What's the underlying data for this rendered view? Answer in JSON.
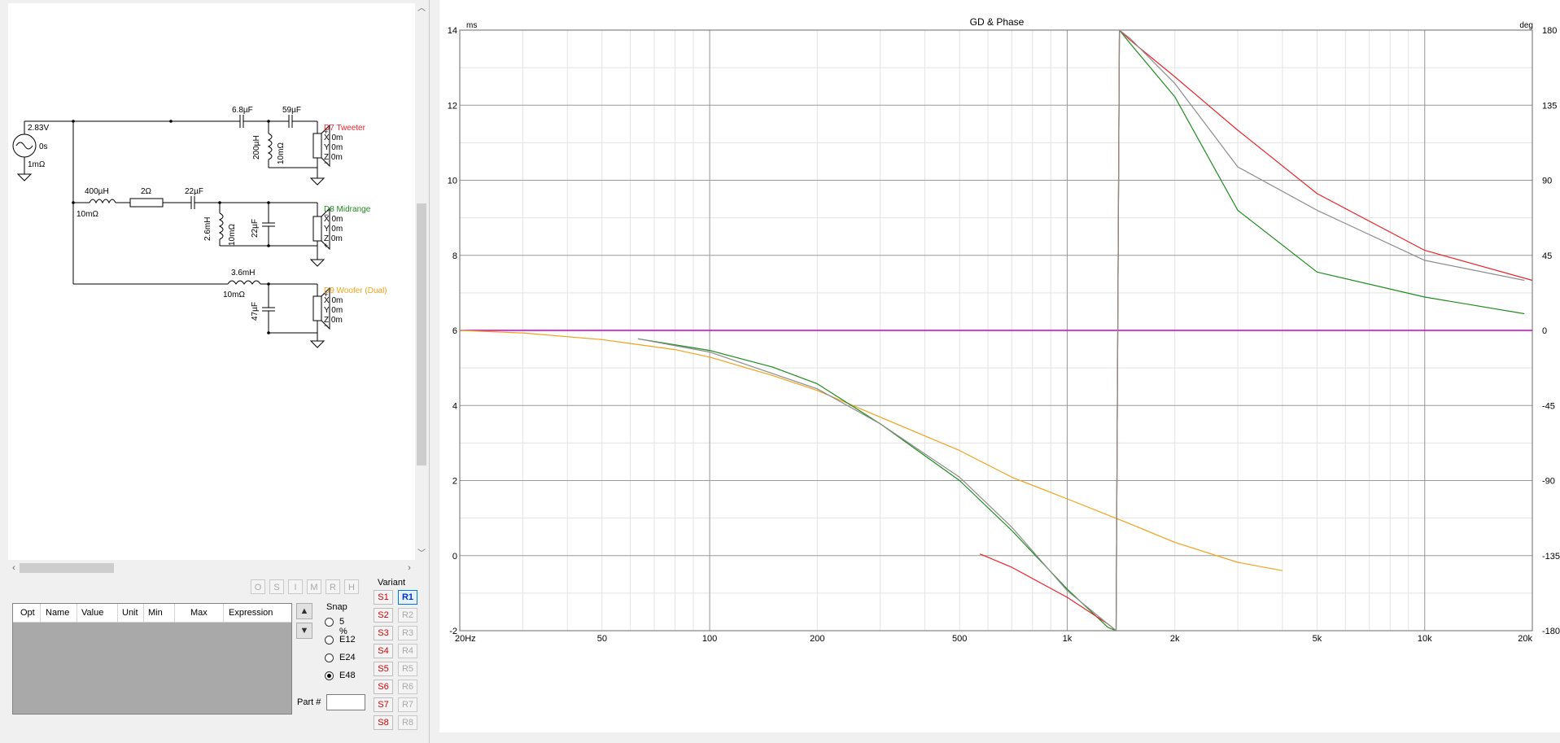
{
  "schematic": {
    "source": {
      "voltage": "2.83V",
      "delay": "0s",
      "resistance": "1mΩ"
    },
    "drivers": [
      {
        "name": "D7 Tweeter",
        "color": "#e8262b",
        "x": "X 0m",
        "y": "Y 0m",
        "z": "Z 0m"
      },
      {
        "name": "D8 Midrange",
        "color": "#1e8c1e",
        "x": "X 0m",
        "y": "Y 0m",
        "z": "Z 0m"
      },
      {
        "name": "D9 Woofer (Dual)",
        "color": "#f2a11b",
        "x": "X 0m",
        "y": "Y 0m",
        "z": "Z 0m"
      }
    ],
    "components": {
      "tw_c1": "6.8µF",
      "tw_c2": "59µF",
      "tw_l": "200µH",
      "tw_lr": "10mΩ",
      "mid_l1": "400µH",
      "mid_l1r": "10mΩ",
      "mid_r": "2Ω",
      "mid_c1": "22µF",
      "mid_l2": "2.6mH",
      "mid_l2r": "10mΩ",
      "mid_c2": "22µF",
      "wf_l": "3.6mH",
      "wf_lr": "10mΩ",
      "wf_c": "47µF"
    }
  },
  "toolbar_buttons": [
    "O",
    "S",
    "I",
    "M",
    "R",
    "H"
  ],
  "param_table": {
    "columns": [
      "Opt",
      "Name",
      "Value",
      "Unit",
      "Min",
      "Max",
      "Expression"
    ]
  },
  "snap": {
    "title": "Snap",
    "options": [
      "5 %",
      "E12",
      "E24",
      "E48"
    ],
    "selected": "E48"
  },
  "part_number": {
    "label": "Part #",
    "value": ""
  },
  "variant": {
    "title": "Variant",
    "s_buttons": [
      "S1",
      "S2",
      "S3",
      "S4",
      "S5",
      "S6",
      "S7",
      "S8"
    ],
    "r_buttons": [
      "R1",
      "R2",
      "R3",
      "R4",
      "R5",
      "R6",
      "R7",
      "R8"
    ],
    "active_r": "R1"
  },
  "chart_data": {
    "type": "line",
    "title": "GD & Phase",
    "y_left_unit": "ms",
    "y_right_unit": "deg",
    "x_scale": "log",
    "x_range": [
      20,
      20000
    ],
    "x_ticks": [
      20,
      50,
      100,
      200,
      500,
      1000,
      2000,
      5000,
      10000,
      20000
    ],
    "x_tick_labels": [
      "20Hz",
      "50",
      "100",
      "200",
      "500",
      "1k",
      "2k",
      "5k",
      "10k",
      "20k"
    ],
    "y_left_range": [
      -2,
      14
    ],
    "y_left_ticks": [
      -2,
      0,
      2,
      4,
      6,
      8,
      10,
      12,
      14
    ],
    "y_right_range": [
      -180,
      180
    ],
    "y_right_ticks": [
      -180,
      -135,
      -90,
      -45,
      0,
      45,
      90,
      135,
      180
    ],
    "grid": true,
    "series": [
      {
        "color": "#cc00cc",
        "axis": "left",
        "x": [
          20,
          20000
        ],
        "y": [
          6.0,
          6.0
        ]
      },
      {
        "color": "#f2a11b",
        "axis": "right",
        "x": [
          20,
          30,
          50,
          80,
          100,
          150,
          200,
          300,
          500,
          700,
          1000,
          1500,
          2000,
          3000,
          4000
        ],
        "y": [
          0,
          -1.5,
          -5.5,
          -11.5,
          -16,
          -27,
          -36,
          -52,
          -72,
          -88,
          -101,
          -116,
          -127,
          -139,
          -144
        ]
      },
      {
        "color": "#1e8c1e",
        "axis": "right",
        "x": [
          63,
          100,
          150,
          200,
          300,
          500,
          700,
          1000,
          1300,
          1370,
          1400,
          1500,
          2000,
          3000,
          5000,
          10000,
          19000
        ],
        "y": [
          -5,
          -12,
          -22,
          -32,
          -56,
          -90,
          -120,
          -155,
          -178,
          -180,
          180,
          172,
          140,
          72,
          35,
          20,
          10
        ]
      },
      {
        "color": "#e8262b",
        "axis": "right",
        "x": [
          570,
          700,
          1000,
          1300,
          1370,
          1400,
          1500,
          2000,
          3000,
          5000,
          10000,
          20000
        ],
        "y": [
          -134,
          -142,
          -160,
          -176,
          -180,
          180,
          174,
          152,
          120,
          82,
          48,
          30
        ]
      },
      {
        "color": "#8c8c8c",
        "axis": "right",
        "x": [
          63,
          100,
          200,
          300,
          500,
          700,
          1000,
          1300,
          1370,
          1400,
          1500,
          2000,
          3000,
          5000,
          10000,
          19000
        ],
        "y": [
          -5,
          -13,
          -35,
          -56,
          -88,
          -118,
          -156,
          -176,
          -180,
          180,
          175,
          148,
          98,
          72,
          42,
          30
        ]
      }
    ]
  }
}
